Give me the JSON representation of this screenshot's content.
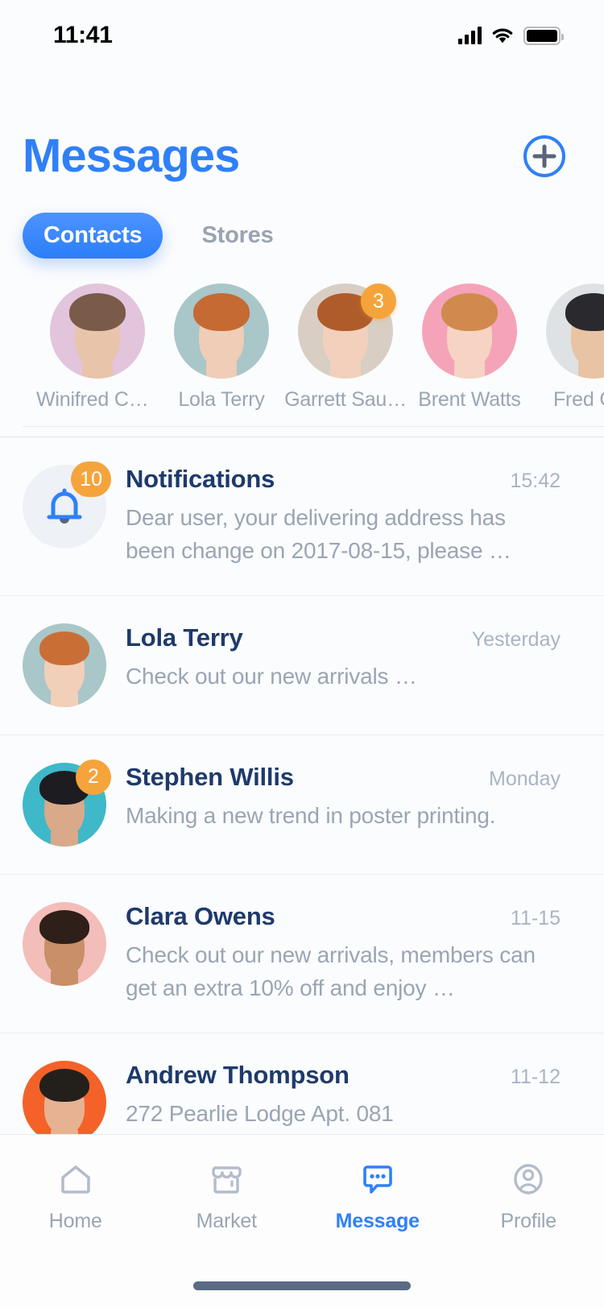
{
  "status_bar": {
    "time": "11:41",
    "signal_icon": "cellular-bars-icon",
    "wifi_icon": "wifi-icon",
    "battery_icon": "battery-full-icon"
  },
  "header": {
    "title": "Messages",
    "add_icon": "plus-circle-icon",
    "title_color": "#2f80f8"
  },
  "tabs": {
    "items": [
      {
        "label": "Contacts",
        "active": true
      },
      {
        "label": "Stores",
        "active": false
      }
    ],
    "active_color": "#2f80f8"
  },
  "stories": [
    {
      "name": "Winifred Co…",
      "badge": "",
      "bg": "#e2c4dd",
      "hair": "#7a5a48",
      "skin": "#e8c4ab"
    },
    {
      "name": "Lola Terry",
      "badge": "",
      "bg": "#a9c6c9",
      "hair": "#c66a33",
      "skin": "#f0cdb6"
    },
    {
      "name": "Garrett Sau…",
      "badge": "3",
      "bg": "#d9cec3",
      "hair": "#b05c2a",
      "skin": "#f2d0bb"
    },
    {
      "name": "Brent Watts",
      "badge": "",
      "bg": "#f5a3b8",
      "hair": "#d08a4e",
      "skin": "#f6d3c2"
    },
    {
      "name": "Fred C…",
      "badge": "",
      "bg": "#dfe2e4",
      "hair": "#2a2a2e",
      "skin": "#e8c3a4"
    }
  ],
  "messages": [
    {
      "name": "Notifications",
      "preview": "Dear user, your delivering address has been change on 2017-08-15, please …",
      "time": "15:42",
      "badge": "10",
      "icon": "bell-icon",
      "is_notification": true
    },
    {
      "name": "Lola Terry",
      "preview": "Check out our new arrivals …",
      "time": "Yesterday",
      "badge": "",
      "bg": "#a9c6c9",
      "hair": "#c96f36",
      "skin": "#f2cfb9"
    },
    {
      "name": "Stephen Willis",
      "preview": "Making a new trend in poster printing.",
      "time": "Monday",
      "badge": "2",
      "bg": "#3fb8c9",
      "hair": "#1d1c20",
      "skin": "#d9a98a"
    },
    {
      "name": "Clara Owens",
      "preview": "Check out our new arrivals, members can get an extra 10% off and enjoy …",
      "time": "11-15",
      "badge": "",
      "bg": "#f3bdb9",
      "hair": "#2e2019",
      "skin": "#c98f68"
    },
    {
      "name": "Andrew Thompson",
      "preview": "272 Pearlie Lodge Apt. 081",
      "time": "11-12",
      "badge": "",
      "bg": "#f4622a",
      "hair": "#23201c",
      "skin": "#e6b292"
    }
  ],
  "bottom_nav": {
    "items": [
      {
        "label": "Home",
        "icon": "home-icon",
        "active": false
      },
      {
        "label": "Market",
        "icon": "store-icon",
        "active": false
      },
      {
        "label": "Message",
        "icon": "chat-bubble-icon",
        "active": true
      },
      {
        "label": "Profile",
        "icon": "user-circle-icon",
        "active": false
      }
    ],
    "active_color": "#2f80f8",
    "inactive_color": "#b3bccb"
  },
  "colors": {
    "accent": "#2f80f8",
    "badge": "#f5a43c",
    "name_text": "#1e3a6b",
    "muted_text": "#9aa5b4",
    "background": "#fbfcfd"
  }
}
